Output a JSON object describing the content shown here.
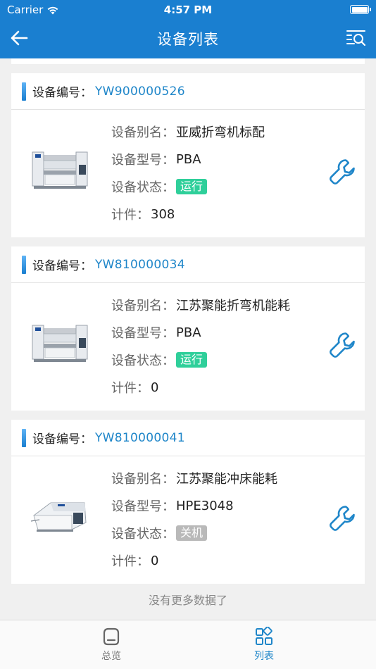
{
  "status_bar": {
    "carrier": "Carrier",
    "time": "4:57 PM"
  },
  "nav": {
    "title": "设备列表"
  },
  "devices": [
    {
      "code_label": "设备编号：",
      "code": "YW900000526",
      "alias_label": "设备别名：",
      "alias": "亚威折弯机标配",
      "model_label": "设备型号：",
      "model": "PBA",
      "status_label": "设备状态：",
      "status": "运行",
      "count_label": "计件：",
      "count": "308",
      "machine": "press-brake",
      "status_color": "#2fcf9a"
    },
    {
      "code_label": "设备编号：",
      "code": "YW810000034",
      "alias_label": "设备别名：",
      "alias": "江苏聚能折弯机能耗",
      "model_label": "设备型号：",
      "model": "PBA",
      "status_label": "设备状态：",
      "status": "运行",
      "count_label": "计件：",
      "count": "0",
      "machine": "press-brake",
      "status_color": "#2fcf9a"
    },
    {
      "code_label": "设备编号：",
      "code": "YW810000041",
      "alias_label": "设备别名：",
      "alias": "江苏聚能冲床能耗",
      "model_label": "设备型号：",
      "model": "HPE3048",
      "status_label": "设备状态：",
      "status": "关机",
      "count_label": "计件：",
      "count": "0",
      "machine": "turret-punch",
      "status_color": "#b9b9b9"
    }
  ],
  "footer_text": "没有更多数据了",
  "tabs": [
    {
      "label": "总览",
      "icon": "overview-icon",
      "active": false
    },
    {
      "label": "列表",
      "icon": "grid-list-icon",
      "active": true
    }
  ],
  "colors": {
    "primary": "#1a7fd0",
    "accent": "#1f86c9",
    "running": "#2fcf9a",
    "off": "#b9b9b9"
  }
}
